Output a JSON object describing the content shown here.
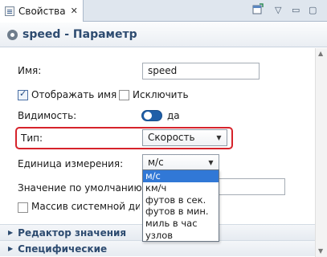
{
  "tab": {
    "label": "Свойства",
    "close_glyph": "✕"
  },
  "toolbar": {
    "view_menu_glyph": "▽",
    "minimize_glyph": "▭",
    "maximize_glyph": "▢"
  },
  "header": {
    "title": "speed - Параметр"
  },
  "form": {
    "name_label": "Имя:",
    "name_value": "speed",
    "show_name_label": "Отображать имя",
    "show_name_checked": true,
    "exclude_label": "Исключить",
    "exclude_checked": false,
    "visibility_label": "Видимость:",
    "visibility_value": "да",
    "type_label": "Тип:",
    "type_value": "Скорость",
    "unit_label": "Единица измерения:",
    "unit_value": "м/с",
    "default_label": "Значение по умолчанию:",
    "array_label": "Массив системной динамики",
    "array_checked": false
  },
  "unit_options": [
    "м/с",
    "км/ч",
    "футов в сек.",
    "футов в мин.",
    "миль в час",
    "узлов"
  ],
  "unit_selected_index": 0,
  "sections": [
    {
      "label": "Редактор значения"
    },
    {
      "label": "Специфические"
    }
  ],
  "colors": {
    "header_text": "#2d4b70",
    "highlight": "#d6232b",
    "selection": "#3178d6",
    "toggle_on": "#1f5fa8"
  }
}
